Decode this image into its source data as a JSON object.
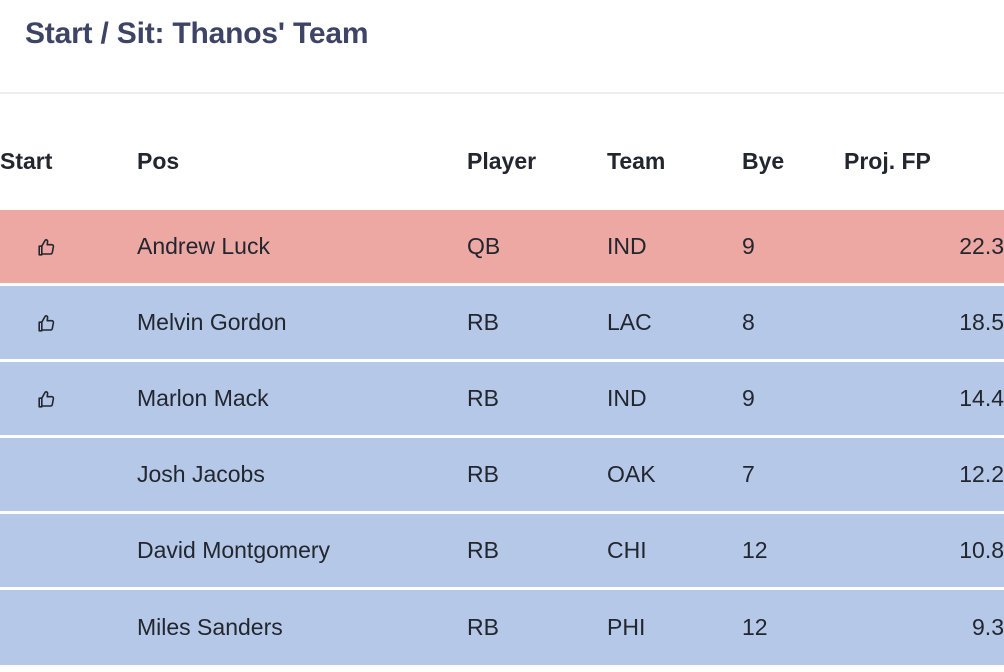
{
  "header": {
    "title": "Start / Sit: Thanos' Team"
  },
  "table": {
    "columns": [
      {
        "key": "start",
        "label": "Start"
      },
      {
        "key": "pos",
        "label": "Pos"
      },
      {
        "key": "player",
        "label": "Player"
      },
      {
        "key": "team",
        "label": "Team"
      },
      {
        "key": "bye",
        "label": "Bye"
      },
      {
        "key": "proj",
        "label": "Proj. FP"
      }
    ],
    "rows": [
      {
        "start_icon": "thumbs-up-icon",
        "name": "Andrew Luck",
        "position": "QB",
        "team": "IND",
        "bye": "9",
        "proj_fp": "22.3",
        "highlight": "start"
      },
      {
        "start_icon": "thumbs-up-icon",
        "name": "Melvin Gordon",
        "position": "RB",
        "team": "LAC",
        "bye": "8",
        "proj_fp": "18.5",
        "highlight": "bench"
      },
      {
        "start_icon": "thumbs-up-icon",
        "name": "Marlon Mack",
        "position": "RB",
        "team": "IND",
        "bye": "9",
        "proj_fp": "14.4",
        "highlight": "bench"
      },
      {
        "start_icon": "",
        "name": "Josh Jacobs",
        "position": "RB",
        "team": "OAK",
        "bye": "7",
        "proj_fp": "12.2",
        "highlight": "bench"
      },
      {
        "start_icon": "",
        "name": "David Montgomery",
        "position": "RB",
        "team": "CHI",
        "bye": "12",
        "proj_fp": "10.8",
        "highlight": "bench"
      },
      {
        "start_icon": "",
        "name": "Miles Sanders",
        "position": "RB",
        "team": "PHI",
        "bye": "12",
        "proj_fp": "9.3",
        "highlight": "bench"
      }
    ]
  },
  "colors": {
    "title": "#3d4466",
    "row_start": "#eda8a3",
    "row_bench": "#b6c8e8",
    "divider": "#eceef3",
    "text": "#22262e"
  }
}
